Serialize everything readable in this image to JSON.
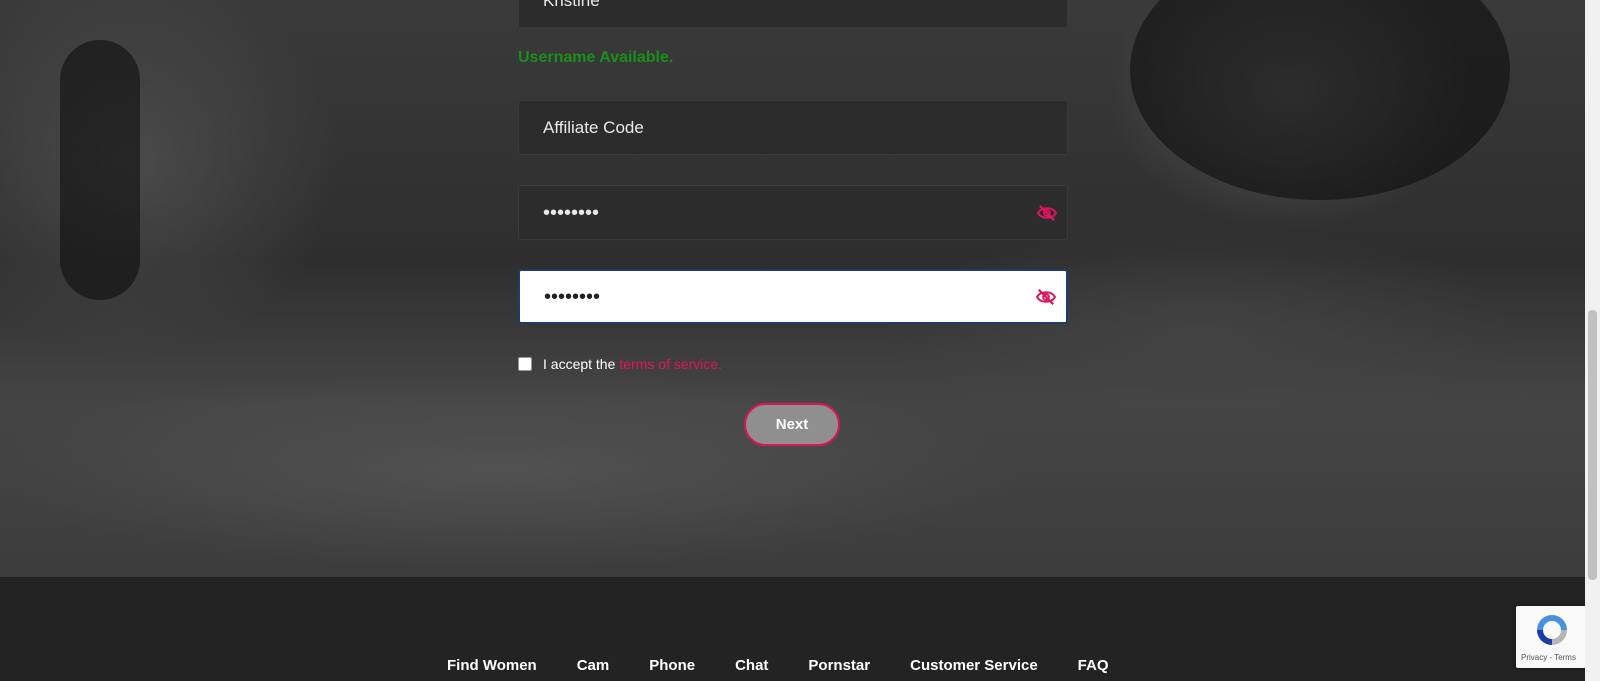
{
  "form": {
    "username_value": "Kristine",
    "username_status": "Username Available.",
    "affiliate_placeholder": "Affiliate Code",
    "password_mask": "••••••••",
    "confirm_password_mask": "••••••••",
    "terms_prefix": "I accept the",
    "terms_link": "terms of service.",
    "next_label": "Next"
  },
  "footer": {
    "links": [
      "Find Women",
      "Cam",
      "Phone",
      "Chat",
      "Pornstar",
      "Customer Service",
      "FAQ"
    ]
  },
  "recaptcha": {
    "text": "Privacy - Terms"
  },
  "icons": {
    "password_toggle": "eye-slash-icon",
    "recaptcha": "recaptcha-icon"
  },
  "colors": {
    "accent": "#e0145c",
    "success": "#1a8f1a",
    "field_bg": "#2c2c2c",
    "footer_bg": "#232323"
  }
}
